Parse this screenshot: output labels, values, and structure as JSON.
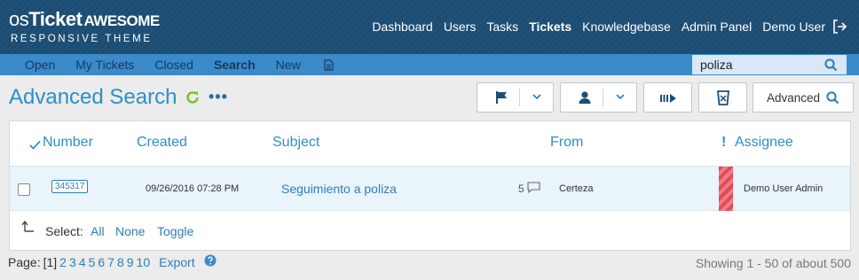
{
  "header": {
    "logo": {
      "os": "os",
      "ticket": "Ticket",
      "awesome": "AWESOME",
      "subtitle": "RESPONSIVE THEME"
    },
    "nav": [
      {
        "label": "Dashboard",
        "active": false
      },
      {
        "label": "Users",
        "active": false
      },
      {
        "label": "Tasks",
        "active": false
      },
      {
        "label": "Tickets",
        "active": true
      },
      {
        "label": "Knowledgebase",
        "active": false
      },
      {
        "label": "Admin Panel",
        "active": false
      },
      {
        "label": "Demo User",
        "active": false
      }
    ]
  },
  "subnav": {
    "tabs": [
      {
        "label": "Open",
        "active": false
      },
      {
        "label": "My Tickets",
        "active": false
      },
      {
        "label": "Closed",
        "active": false
      },
      {
        "label": "Search",
        "active": true
      },
      {
        "label": "New",
        "active": false
      }
    ],
    "search": {
      "value": "poliza"
    }
  },
  "page": {
    "title": "Advanced Search",
    "more": "•••",
    "advanced_button": "Advanced"
  },
  "table": {
    "columns": {
      "number": "Number",
      "created": "Created",
      "subject": "Subject",
      "from": "From",
      "priority": "!",
      "assignee": "Assignee"
    },
    "rows": [
      {
        "number": "345317",
        "created": "09/26/2016 07:28 PM",
        "subject": "Seguimiento a poliza",
        "thread_count": "5",
        "from": "Certeza",
        "assignee": "Demo User Admin",
        "priority_color": "#e34a55"
      }
    ],
    "select": {
      "label": "Select:",
      "all": "All",
      "none": "None",
      "toggle": "Toggle"
    }
  },
  "footer": {
    "page_label": "Page:",
    "current_page": "[1]",
    "pages": [
      "2",
      "3",
      "4",
      "5",
      "6",
      "7",
      "8",
      "9",
      "10"
    ],
    "export": "Export",
    "showing": "Showing 1 - 50 of about 500"
  },
  "colors": {
    "header_bg": "#1d4e74",
    "subnav_bg": "#3b8ac9",
    "accent": "#2c8fc9",
    "link": "#2c7fb8",
    "refresh": "#7bbf2a"
  }
}
